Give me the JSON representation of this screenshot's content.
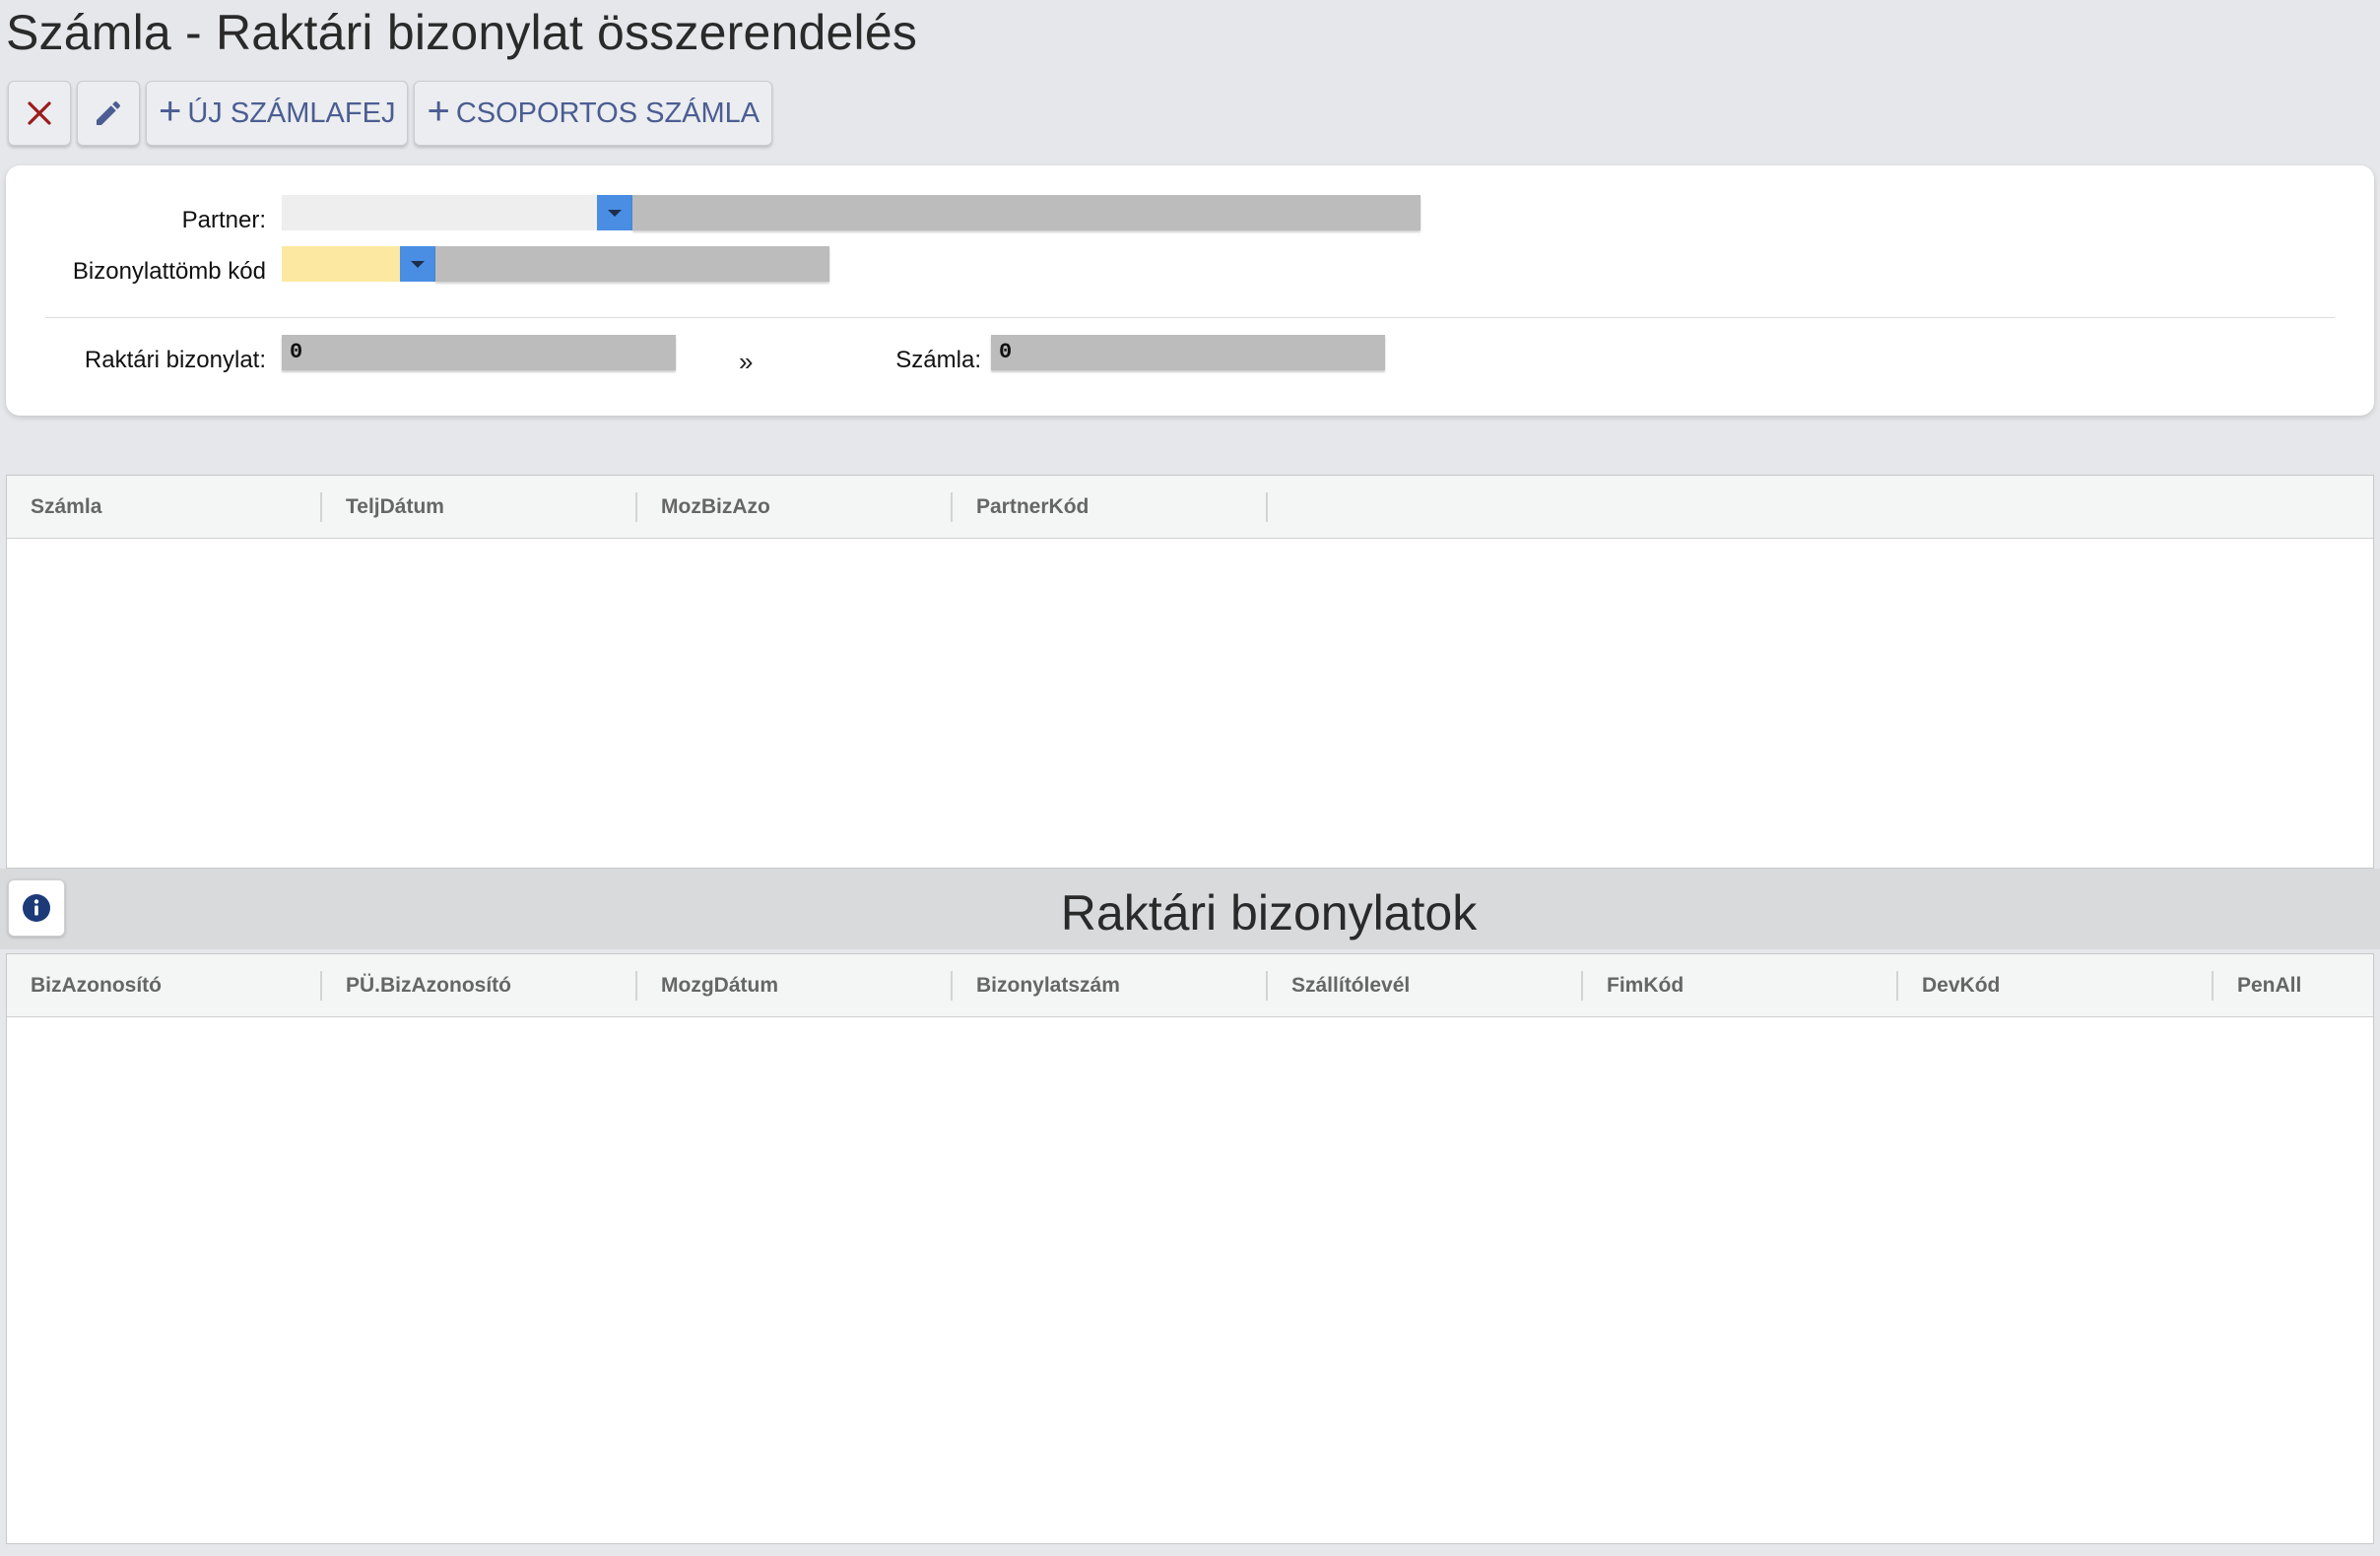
{
  "page": {
    "title": "Számla - Raktári bizonylat összerendelés"
  },
  "toolbar": {
    "new_invoice_header_label": "ÚJ SZÁMLAFEJ",
    "group_invoice_label": "CSOPORTOS SZÁMLA"
  },
  "filters": {
    "partner_label": "Partner:",
    "partner_value": "",
    "doc_block_label": "Bizonylattömb kód",
    "doc_block_value": "",
    "warehouse_doc_label": "Raktári bizonylat:",
    "warehouse_doc_value": "0",
    "arrow": "»",
    "invoice_label": "Számla:",
    "invoice_value": "0"
  },
  "invoice_grid": {
    "columns": [
      "Számla",
      "TeljDátum",
      "MozBizAzo",
      "PartnerKód"
    ],
    "rows": []
  },
  "warehouse_section": {
    "title": "Raktári bizonylatok"
  },
  "warehouse_grid": {
    "columns": [
      "BizAzonosító",
      "PÜ.BizAzonosító",
      "MozgDátum",
      "Bizonylatszám",
      "Szállítólevél",
      "FimKód",
      "DevKód",
      "PenAll"
    ],
    "rows": []
  },
  "colors": {
    "accent_blue": "#4a8ee3",
    "required_yellow": "#fce8a0",
    "toolbar_text": "#4b5d92",
    "close_red": "#9b1c1c",
    "info_navy": "#1d3a78"
  },
  "icons": {
    "close": "close-icon",
    "edit": "pencil-icon",
    "add": "plus-icon",
    "dropdown": "chevron-down-icon",
    "info": "info-icon"
  }
}
